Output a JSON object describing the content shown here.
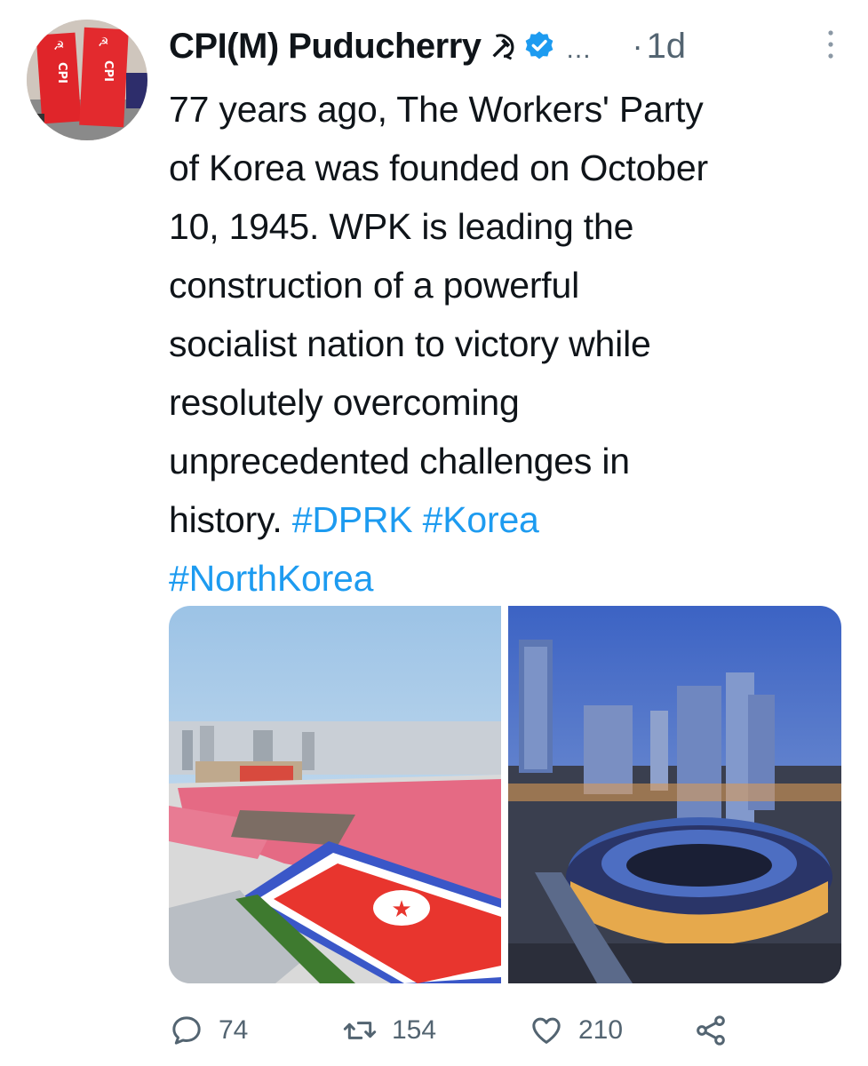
{
  "tweet": {
    "author_name": "CPI(M) Puducherry",
    "more_label": "...",
    "separator": "·",
    "timestamp": "1d",
    "text_lines": [
      "77 years ago, The Workers' Party",
      "of Korea was founded on October",
      "10, 1945. WPK is leading the",
      "construction of a powerful",
      "socialist nation to victory while",
      "resolutely overcoming",
      "unprecedented challenges in",
      "history."
    ],
    "hashtags": [
      "#DPRK",
      "#Korea",
      "#NorthKorea"
    ]
  },
  "actions": {
    "replies": "74",
    "retweets": "154",
    "likes": "210"
  },
  "colors": {
    "accent": "#1d9bf0",
    "text": "#0f1419",
    "muted": "#536471",
    "flag_red": "#e8352e",
    "flag_blue": "#3a57c8"
  },
  "icons": {
    "reply": "speech-bubble-icon",
    "retweet": "retweet-arrows-icon",
    "like": "heart-outline-icon",
    "share": "share-nodes-icon",
    "verified": "verified-badge-icon",
    "emblem": "hammer-sickle-icon"
  }
}
